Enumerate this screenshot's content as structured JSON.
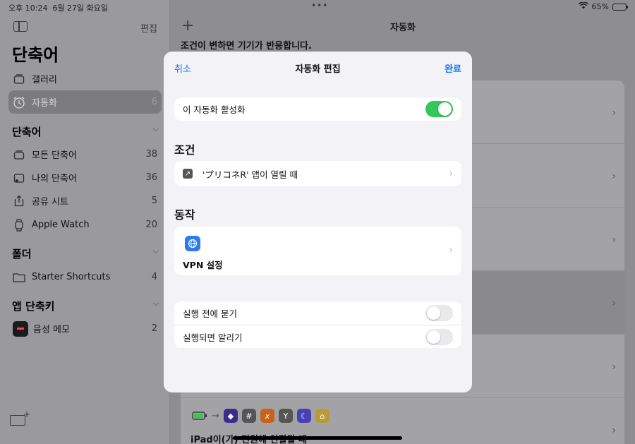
{
  "status": {
    "time": "오후 10:24",
    "date": "6월 27일 화요일",
    "battery": "65%",
    "battery_level": 0.65
  },
  "sidebar": {
    "edit_label": "편집",
    "title": "단축어",
    "top_items": [
      {
        "label": "갤러리",
        "icon": "gallery-icon"
      },
      {
        "label": "자동화",
        "count": "6",
        "icon": "clock-icon",
        "active": true
      }
    ],
    "sections": [
      {
        "title": "단축어",
        "items": [
          {
            "label": "모든 단축어",
            "count": "38",
            "icon": "shortcuts-icon"
          },
          {
            "label": "나의 단축어",
            "count": "36",
            "icon": "person-icon"
          },
          {
            "label": "공유 시트",
            "count": "5",
            "icon": "share-icon"
          },
          {
            "label": "Apple Watch",
            "count": "20",
            "icon": "watch-icon"
          }
        ]
      },
      {
        "title": "폴더",
        "items": [
          {
            "label": "Starter Shortcuts",
            "count": "4",
            "icon": "folder-icon"
          }
        ]
      },
      {
        "title": "앱 단축키",
        "items": [
          {
            "label": "음성 메모",
            "count": "2",
            "icon": "voice-memo-icon"
          }
        ]
      }
    ]
  },
  "main": {
    "title": "자동화",
    "description": "조건이 변하면 기기가 반응합니다.",
    "last_row_text": "iPad이(가) 전원에 연결될 때"
  },
  "modal": {
    "cancel_label": "취소",
    "title": "자동화 편집",
    "done_label": "완료",
    "enable_label": "이 자동화 활성화",
    "enable_on": true,
    "condition_section": "조건",
    "condition_label": "'プリコネR' 앱이 열릴 때",
    "action_section": "동작",
    "action_label": "VPN 설정",
    "ask_before_label": "실행 전에 묻기",
    "ask_before_on": false,
    "notify_label": "실행되면 알리기",
    "notify_on": false
  },
  "colors": {
    "accent": "#1a7cf5",
    "toggle_on": "#34c759",
    "vpn_icon": "#2c7bf2"
  }
}
